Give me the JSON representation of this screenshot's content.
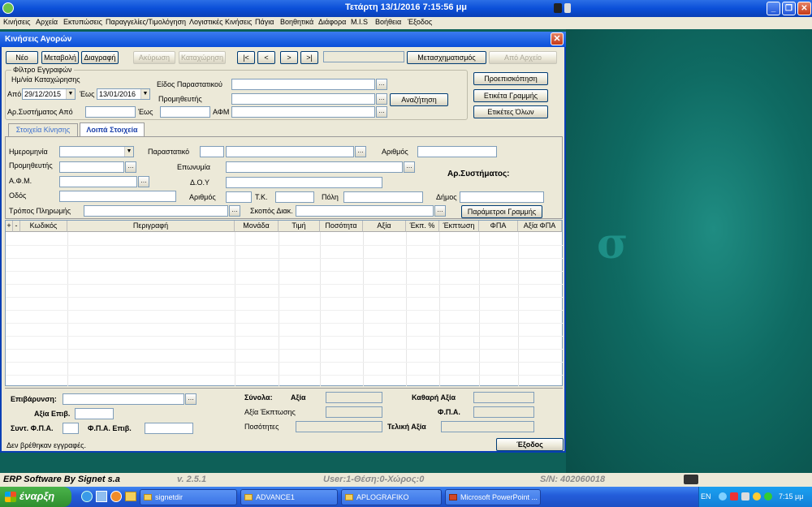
{
  "titlebar": {
    "title": "Τετάρτη  13/1/2016 7:15:56 μμ"
  },
  "menu": [
    "Κινήσεις",
    "Αρχεία",
    "Εκτυπώσεις",
    "Παραγγελίες/Τιμολόγηση",
    "Λογιστικές Κινήσεις",
    "Πάγια",
    "Βοηθητικά",
    "Διάφορα",
    "M.I.S",
    "Βοήθεια",
    "Έξοδος"
  ],
  "window": {
    "title": "Κινήσεις  Αγορών"
  },
  "toolbar": {
    "new": "Νέο",
    "edit": "Μεταβολή",
    "delete": "Διαγραφή",
    "cancel": "Ακύρωση",
    "save": "Καταχώρηση",
    "first": "|<",
    "prev": "<",
    "next": ">",
    "last": ">|",
    "transform": "Μετασχηματισμός",
    "from_file": "Από Αρχείο"
  },
  "filter": {
    "group": "Φίλτρο Εγγραφών",
    "date_group": "Ημ/νία Καταχώρησης",
    "from_label": "Από",
    "from_value": "29/12/2015",
    "to_label": "Έως",
    "to_value": "13/01/2016",
    "doc_type": "Είδος Παραστατικού",
    "supplier": "Προμηθευτής",
    "sys_no_from": "Αρ.Συστήματος Από",
    "sys_no_to": "Έως",
    "vat_no": "ΑΦΜ",
    "search": "Αναζήτηση"
  },
  "side_buttons": {
    "preview": "Προεπισκόπηση",
    "line_label": "Ετικέτα Γραμμής",
    "all_labels": "Ετικέτες Όλων"
  },
  "tabs": {
    "tab1": "Στοιχεία Κίνησης",
    "tab2": "Λοιπά Στοιχεία"
  },
  "details": {
    "date": "Ημερομηνία",
    "document": "Παραστατικό",
    "number": "Αριθμός",
    "supplier": "Προμηθευτής",
    "name": "Επωνυμία",
    "sys_no": "Αρ.Συστήματος:",
    "vat": "Α.Φ.Μ.",
    "tax_office": "Δ.Ο.Υ",
    "street": "Οδός",
    "street_no": "Αριθμός",
    "postcode": "Τ.Κ.",
    "city": "Πόλη",
    "municipality": "Δήμος",
    "payment": "Τρόπος Πληρωμής",
    "purpose": "Σκοπός Διακ.",
    "line_params": "Παράμετροι Γραμμής"
  },
  "grid": {
    "columns": [
      "+",
      "-",
      "Κωδικός",
      "Περιγραφή",
      "Μονάδα",
      "Τιμή",
      "Ποσότητα",
      "Αξία",
      "Έκπ. %",
      "Έκπτωση",
      "ΦΠΑ",
      "Αξία ΦΠΑ"
    ]
  },
  "footer": {
    "surcharge": "Επιβάρυνση:",
    "surcharge_value": "Αξία Επιβ.",
    "vat_coef": "Συντ. Φ.Π.Α.",
    "vat_surcharge": "Φ.Π.Α. Επιβ.",
    "totals": "Σύνολα:",
    "value": "Αξία",
    "discount_value": "Αξία Έκπτωσης",
    "quantities": "Ποσότητες",
    "net_value": "Καθαρή Αξία",
    "vat": "Φ.Π.Α.",
    "final_value": "Τελική Αξία",
    "no_records": "Δεν βρέθηκαν εγγραφές.",
    "exit": "Έξοδος"
  },
  "statusbar": {
    "software": "ERP Software By Signet s.a",
    "version": "v. 2.5.1",
    "user": "User:1-Θέση:0-Χώρος:0",
    "serial": "S/N: 402060018"
  },
  "taskbar": {
    "start": "έναρξη",
    "tasks": [
      "signetdir",
      "ADVANCE1",
      "APLOGRAFIKO",
      "Microsoft PowerPoint ..."
    ],
    "lang": "EN",
    "clock": "7:15 μμ"
  }
}
